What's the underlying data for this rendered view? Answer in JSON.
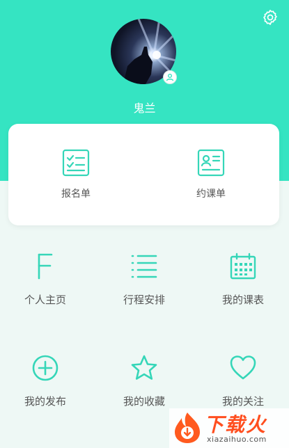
{
  "colors": {
    "accent": "#35e4c2",
    "background": "#eef8f5",
    "watermark": "#ff4e1f"
  },
  "profile": {
    "username": "鬼兰",
    "avatar_icon": "avatar-photo",
    "badge_icon": "user-icon"
  },
  "header": {
    "settings_icon": "gear-icon"
  },
  "card": {
    "items": [
      {
        "label": "报名单",
        "icon": "checklist-icon"
      },
      {
        "label": "约课单",
        "icon": "id-card-icon"
      }
    ]
  },
  "grid": {
    "items": [
      {
        "label": "个人主页",
        "icon": "f-letter-icon"
      },
      {
        "label": "行程安排",
        "icon": "list-icon"
      },
      {
        "label": "我的课表",
        "icon": "calendar-icon"
      },
      {
        "label": "我的发布",
        "icon": "plus-circle-icon"
      },
      {
        "label": "我的收藏",
        "icon": "star-icon"
      },
      {
        "label": "我的关注",
        "icon": "heart-icon"
      }
    ]
  },
  "watermark": {
    "title": "下载火",
    "url": "xiazaihuo.com"
  }
}
